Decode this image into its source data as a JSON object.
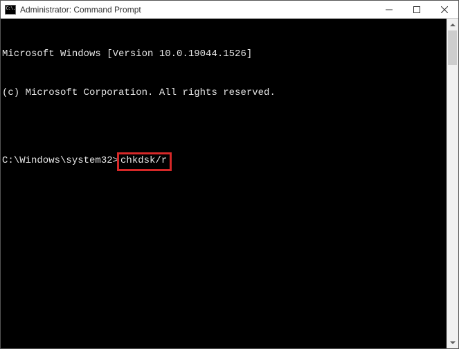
{
  "window": {
    "title": "Administrator: Command Prompt",
    "icon_label": "C:\\."
  },
  "terminal": {
    "line1": "Microsoft Windows [Version 10.0.19044.1526]",
    "line2": "(c) Microsoft Corporation. All rights reserved.",
    "blank": "",
    "prompt": "C:\\Windows\\system32>",
    "command": "chkdsk/r"
  }
}
